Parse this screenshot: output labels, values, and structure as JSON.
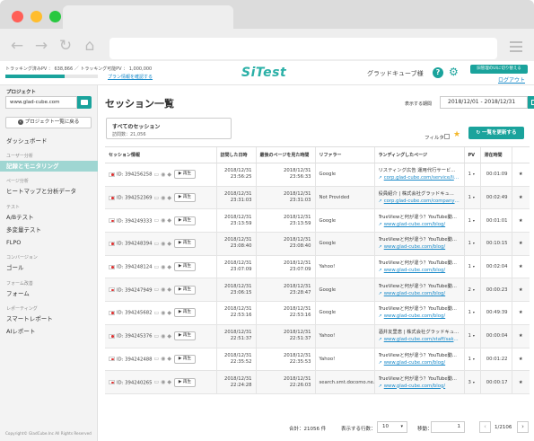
{
  "browser": {
    "colors": {
      "close": "#ff5f57",
      "minimize": "#ffbd2e",
      "maximize": "#28c840"
    },
    "nav_icons": {
      "back": "←",
      "forward": "→",
      "reload": "↻",
      "home": "⌂"
    }
  },
  "topbar": {
    "tracking_stats": "トラッキング済みPV ： 638,866 ／ トラッキング可能PV ： 1,000,000",
    "tracking_progress_fraction": 0.64,
    "plan_link": "プラン情報を確認する",
    "logo": "SiTest",
    "user_name": "グラッドキューブ様",
    "help_icon": "?",
    "gear_icon": "⚙",
    "switch_button": "旧管理のUIに切り替える",
    "logout": "ログアウト",
    "accent": "#1aa39c"
  },
  "sidebar": {
    "project_label": "プロジェクト",
    "project_value": "www.glad-cube.com",
    "back_button": "プロジェクト一覧に戻る",
    "groups": [
      {
        "section": "ユーザー分析",
        "items": [
          {
            "label": "ダッシュボード",
            "active": false
          },
          {
            "label": "記録とモニタリング",
            "active": true
          }
        ]
      },
      {
        "section": "ページ分析",
        "items": [
          {
            "label": "ヒートマップと分析データ",
            "active": false
          }
        ]
      },
      {
        "section": "テスト",
        "items": [
          {
            "label": "A/Bテスト",
            "active": false
          },
          {
            "label": "多変量テスト",
            "active": false
          },
          {
            "label": "FLPO",
            "active": false
          }
        ]
      },
      {
        "section": "コンバージョン",
        "items": [
          {
            "label": "ゴール",
            "active": false
          }
        ]
      },
      {
        "section": "フォーム改善",
        "items": [
          {
            "label": "フォーム",
            "active": false
          }
        ]
      },
      {
        "section": "レポーティング",
        "items": [
          {
            "label": "スマートレポート",
            "active": false
          },
          {
            "label": "AIレポート",
            "active": false
          }
        ]
      }
    ],
    "dashboard_label": "ダッシュボード",
    "copyright": "Copyright© GladCube.Inc All Rights Reserved"
  },
  "main": {
    "title": "セッション一覧",
    "period_label": "表示する期間",
    "period_value": "2018/12/01 - 2018/12/31",
    "segment_name": "すべてのセッション",
    "segment_count": "訪問数：21,056",
    "filter_label": "フィルタ",
    "refresh_button": "一覧を更新する"
  },
  "table": {
    "headers": [
      "セッション情報",
      "訪問した日時",
      "最後のページを見た時間",
      "リファラー",
      "ランディングしたページ",
      "PV",
      "滞在時間",
      ""
    ],
    "play_label": "▶ 再生",
    "rows": [
      {
        "id": "ID: 394256258",
        "visit": [
          "2018/12/31",
          "23:56:25"
        ],
        "last": [
          "2018/12/31",
          "23:56:33"
        ],
        "referrer": "Google",
        "lp_title": "リスティング広告 運用代行サービ...",
        "lp_url": "corp.glad-cube.com/service/list...",
        "pv": "1",
        "stay": "00:01:09"
      },
      {
        "id": "ID: 394252369",
        "visit": [
          "2018/12/31",
          "23:31:03"
        ],
        "last": [
          "2018/12/31",
          "23:31:03"
        ],
        "referrer": "Not Provided",
        "lp_title": "役員紹介 | 株式会社グラッドキュ...",
        "lp_url": "corp.glad-cube.com/company/c...",
        "pv": "1",
        "stay": "00:02:49"
      },
      {
        "id": "ID: 394249333",
        "visit": [
          "2018/12/31",
          "23:13:59"
        ],
        "last": [
          "2018/12/31",
          "23:13:59"
        ],
        "referrer": "Google",
        "lp_title": "TrueViewと何が違う？YouTube動...",
        "lp_url": "www.glad-cube.com/blog/",
        "pv": "1",
        "stay": "00:01:01"
      },
      {
        "id": "ID: 394248394",
        "visit": [
          "2018/12/31",
          "23:08:40"
        ],
        "last": [
          "2018/12/31",
          "23:08:40"
        ],
        "referrer": "Google",
        "lp_title": "TrueViewと何が違う？YouTube動...",
        "lp_url": "www.glad-cube.com/blog/",
        "pv": "1",
        "stay": "00:10:15"
      },
      {
        "id": "ID: 394248124",
        "visit": [
          "2018/12/31",
          "23:07:09"
        ],
        "last": [
          "2018/12/31",
          "23:07:09"
        ],
        "referrer": "Yahoo!",
        "lp_title": "TrueViewと何が違う？YouTube動...",
        "lp_url": "www.glad-cube.com/blog/",
        "pv": "1",
        "stay": "00:02:04"
      },
      {
        "id": "ID: 394247949",
        "visit": [
          "2018/12/31",
          "23:06:15"
        ],
        "last": [
          "2018/12/31",
          "23:28:47"
        ],
        "referrer": "Google",
        "lp_title": "TrueViewと何が違う？YouTube動...",
        "lp_url": "www.glad-cube.com/blog/",
        "pv": "2",
        "stay": "00:00:23"
      },
      {
        "id": "ID: 394245682",
        "visit": [
          "2018/12/31",
          "22:53:16"
        ],
        "last": [
          "2018/12/31",
          "22:53:16"
        ],
        "referrer": "Google",
        "lp_title": "TrueViewと何が違う？YouTube動...",
        "lp_url": "www.glad-cube.com/blog/",
        "pv": "1",
        "stay": "00:49:39"
      },
      {
        "id": "ID: 394245376",
        "visit": [
          "2018/12/31",
          "22:51:37"
        ],
        "last": [
          "2018/12/31",
          "22:51:37"
        ],
        "referrer": "Yahoo!",
        "lp_title": "酒井友里恵 | 株式会社グラッドキュ...",
        "lp_url": "www.glad-cube.com/staff/saka...",
        "pv": "1",
        "stay": "00:00:04"
      },
      {
        "id": "ID: 394242488",
        "visit": [
          "2018/12/31",
          "22:35:52"
        ],
        "last": [
          "2018/12/31",
          "22:35:53"
        ],
        "referrer": "Yahoo!",
        "lp_title": "TrueViewと何が違う？YouTube動...",
        "lp_url": "www.glad-cube.com/blog/",
        "pv": "1",
        "stay": "00:01:22"
      },
      {
        "id": "ID: 394240265",
        "visit": [
          "2018/12/31",
          "22:24:28"
        ],
        "last": [
          "2018/12/31",
          "22:26:03"
        ],
        "referrer": "search.smt.docomo.ne.jp",
        "lp_title": "TrueViewと何が違う？YouTube動...",
        "lp_url": "www.glad-cube.com/blog/",
        "pv": "3",
        "stay": "00:00:17"
      }
    ]
  },
  "footer": {
    "total": "合計：21056 件",
    "rows_label": "表示する行数：",
    "rows_value": "10",
    "move_label": "移動：",
    "move_value": "1",
    "prev": "‹",
    "page": "1/2106",
    "next": "›"
  }
}
